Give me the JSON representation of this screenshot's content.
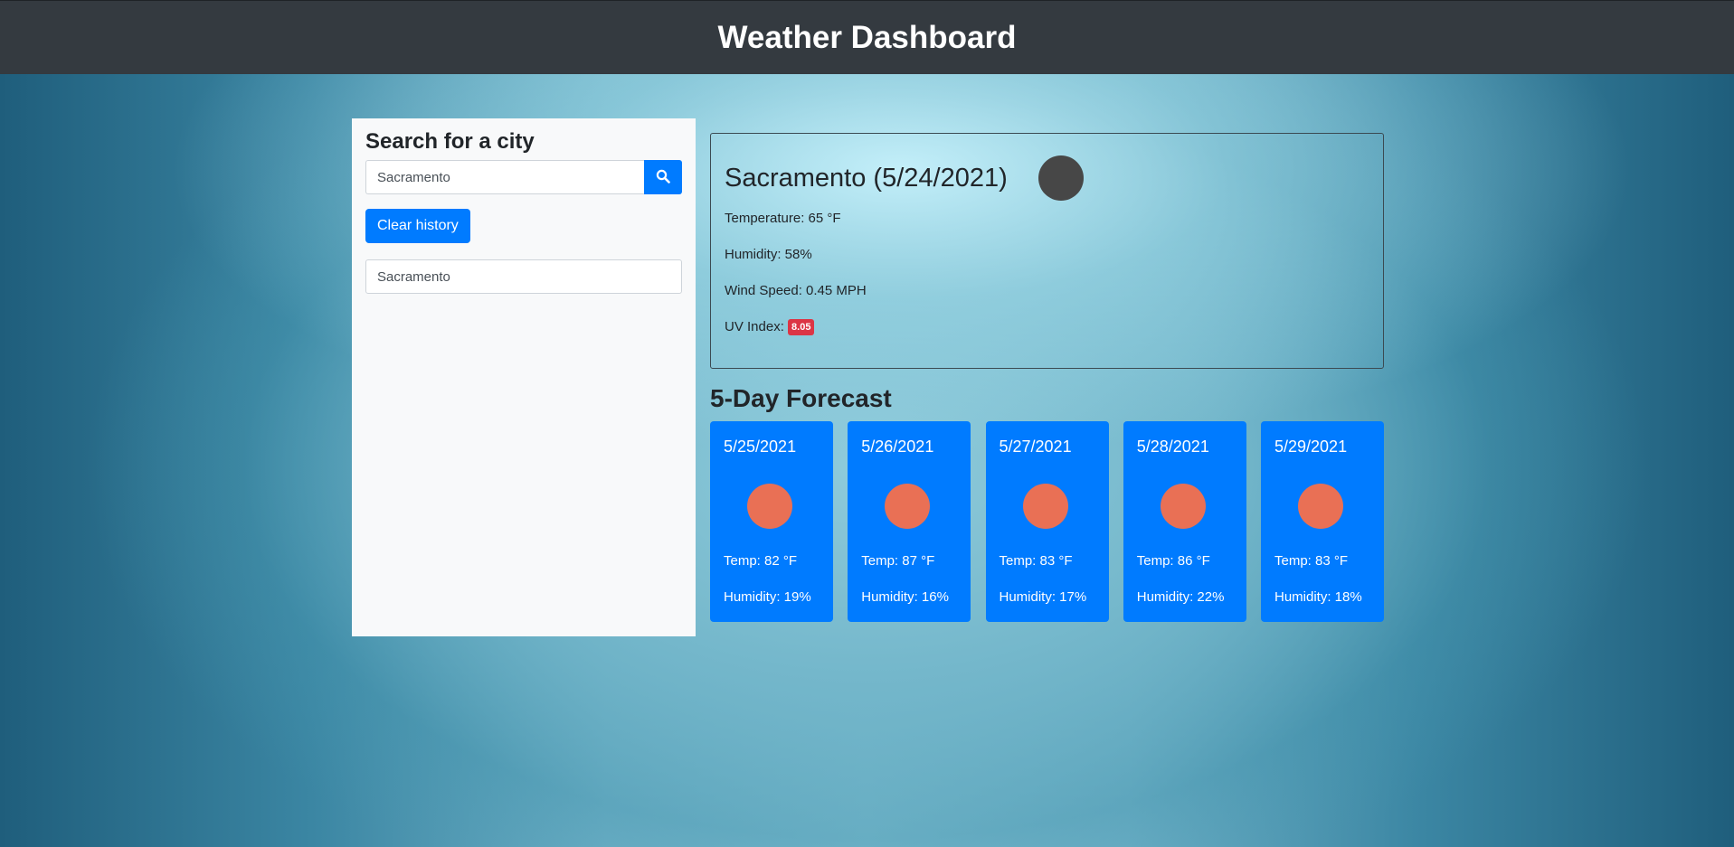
{
  "header": {
    "title": "Weather Dashboard"
  },
  "search": {
    "heading": "Search for a city",
    "input_value": "Sacramento",
    "button_icon": "search-icon",
    "clear_label": "Clear history",
    "history": [
      "Sacramento"
    ]
  },
  "current": {
    "title": "Sacramento (5/24/2021)",
    "temperature": "Temperature: 65 °F",
    "humidity": "Humidity: 58%",
    "wind": "Wind Speed: 0.45 MPH",
    "uv_label": "UV Index:",
    "uv_value": "8.05",
    "uv_color": "#dc3545"
  },
  "forecast": {
    "title": "5-Day Forecast",
    "days": [
      {
        "date": "5/25/2021",
        "temp": "Temp: 82 °F",
        "humidity": "Humidity: 19%"
      },
      {
        "date": "5/26/2021",
        "temp": "Temp: 87 °F",
        "humidity": "Humidity: 16%"
      },
      {
        "date": "5/27/2021",
        "temp": "Temp: 83 °F",
        "humidity": "Humidity: 17%"
      },
      {
        "date": "5/28/2021",
        "temp": "Temp: 86 °F",
        "humidity": "Humidity: 22%"
      },
      {
        "date": "5/29/2021",
        "temp": "Temp: 83 °F",
        "humidity": "Humidity: 18%"
      }
    ]
  },
  "colors": {
    "navbar": "#343a40",
    "primary": "#007bff",
    "sun": "#e97055",
    "danger": "#dc3545"
  }
}
